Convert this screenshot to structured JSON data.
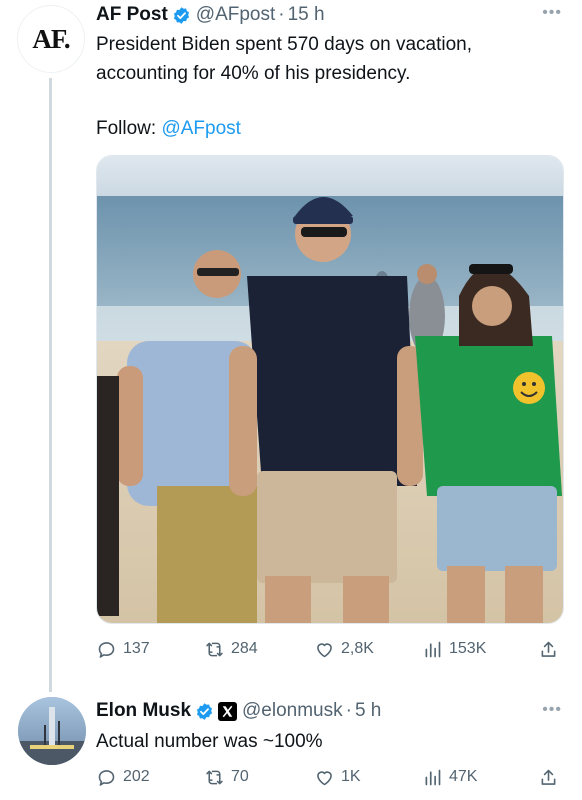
{
  "tweet1": {
    "avatar_text": "AF.",
    "name": "AF Post",
    "handle": "@AFpost",
    "time": "15 h",
    "text_line1": "President Biden spent 570 days on vacation,",
    "text_line2": "accounting for 40% of his presidency.",
    "follow_label": "Follow:",
    "follow_link": "@AFpost",
    "replies": "137",
    "retweets": "284",
    "likes": "2,8K",
    "views": "153K"
  },
  "tweet2": {
    "name": "Elon Musk",
    "handle": "@elonmusk",
    "time": "5 h",
    "text": "Actual number was ~100%",
    "replies": "202",
    "retweets": "70",
    "likes": "1K",
    "views": "47K"
  },
  "icons": {
    "more": "more-dots-icon",
    "verified": "verified-badge-icon",
    "reply": "reply-icon",
    "retweet": "retweet-icon",
    "like": "heart-icon",
    "views": "views-bar-icon",
    "share": "share-icon"
  },
  "colors": {
    "text": "#0f1419",
    "muted": "#536471",
    "link": "#1d9bf0",
    "verified": "#1d9bf0",
    "thread_line": "#cfd9de"
  }
}
